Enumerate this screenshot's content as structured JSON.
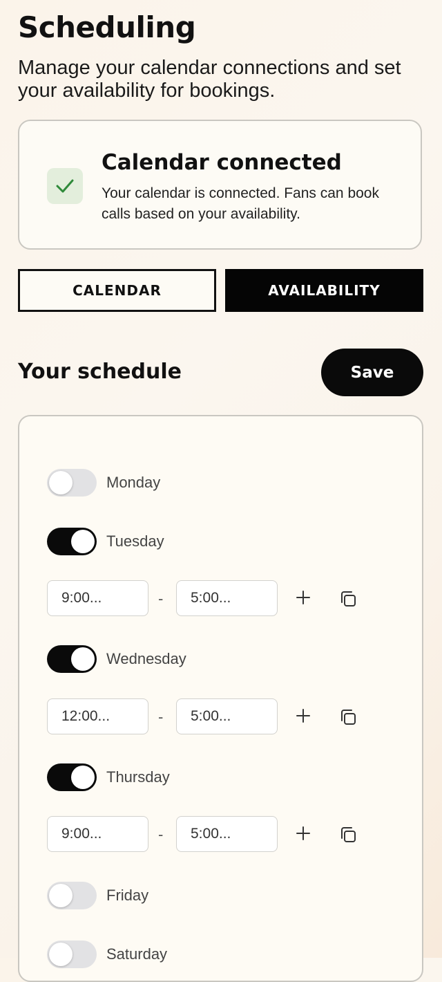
{
  "header": {
    "title": "Scheduling",
    "subtitle": "Manage your calendar connections and set your availability for bookings."
  },
  "status": {
    "icon": "check-icon",
    "title": "Calendar connected",
    "text": "Your calendar is connected. Fans can book calls based on your availability."
  },
  "tabs": {
    "calendar": "CALENDAR",
    "availability": "AVAILABILITY",
    "active": "availability"
  },
  "schedule": {
    "title": "Your schedule",
    "save_label": "Save",
    "separator": "-",
    "days": [
      {
        "name": "Monday",
        "enabled": false
      },
      {
        "name": "Tuesday",
        "enabled": true,
        "start": "9:00...",
        "end": "5:00..."
      },
      {
        "name": "Wednesday",
        "enabled": true,
        "start": "12:00...",
        "end": "5:00..."
      },
      {
        "name": "Thursday",
        "enabled": true,
        "start": "9:00...",
        "end": "5:00..."
      },
      {
        "name": "Friday",
        "enabled": false
      },
      {
        "name": "Saturday",
        "enabled": false
      }
    ]
  },
  "colors": {
    "accent": "#0a0a0a",
    "check": "#2f8a3a",
    "check_bg": "#e3eedc"
  }
}
